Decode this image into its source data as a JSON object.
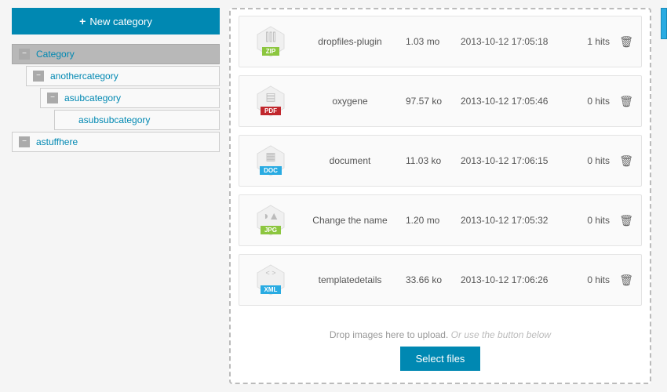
{
  "new_category_label": "New category",
  "tree": [
    {
      "label": "Category",
      "active": true,
      "indent": 0,
      "collapsible": true
    },
    {
      "label": "anothercategory",
      "active": false,
      "indent": 1,
      "collapsible": true
    },
    {
      "label": "asubcategory",
      "active": false,
      "indent": 2,
      "collapsible": true
    },
    {
      "label": "asubsubcategory",
      "active": false,
      "indent": 3,
      "collapsible": false
    },
    {
      "label": "astuffhere",
      "active": false,
      "indent": 0,
      "collapsible": true
    }
  ],
  "files": [
    {
      "type": "ZIP",
      "type_class": "zip",
      "name": "dropfiles-plugin",
      "size": "1.03 mo",
      "date": "2013-10-12 17:05:18",
      "hits": "1 hits"
    },
    {
      "type": "PDF",
      "type_class": "pdf",
      "name": "oxygene",
      "size": "97.57 ko",
      "date": "2013-10-12 17:05:46",
      "hits": "0 hits"
    },
    {
      "type": "DOC",
      "type_class": "doc",
      "name": "document",
      "size": "11.03 ko",
      "date": "2013-10-12 17:06:15",
      "hits": "0 hits"
    },
    {
      "type": "JPG",
      "type_class": "jpg",
      "name": "Change the name",
      "size": "1.20 mo",
      "date": "2013-10-12 17:05:32",
      "hits": "0 hits"
    },
    {
      "type": "XML",
      "type_class": "xml",
      "name": "templatedetails",
      "size": "33.66 ko",
      "date": "2013-10-12 17:06:26",
      "hits": "0 hits"
    }
  ],
  "drop_text": "Drop images here to upload.",
  "drop_hint": "Or use the button below",
  "select_files_label": "Select files"
}
